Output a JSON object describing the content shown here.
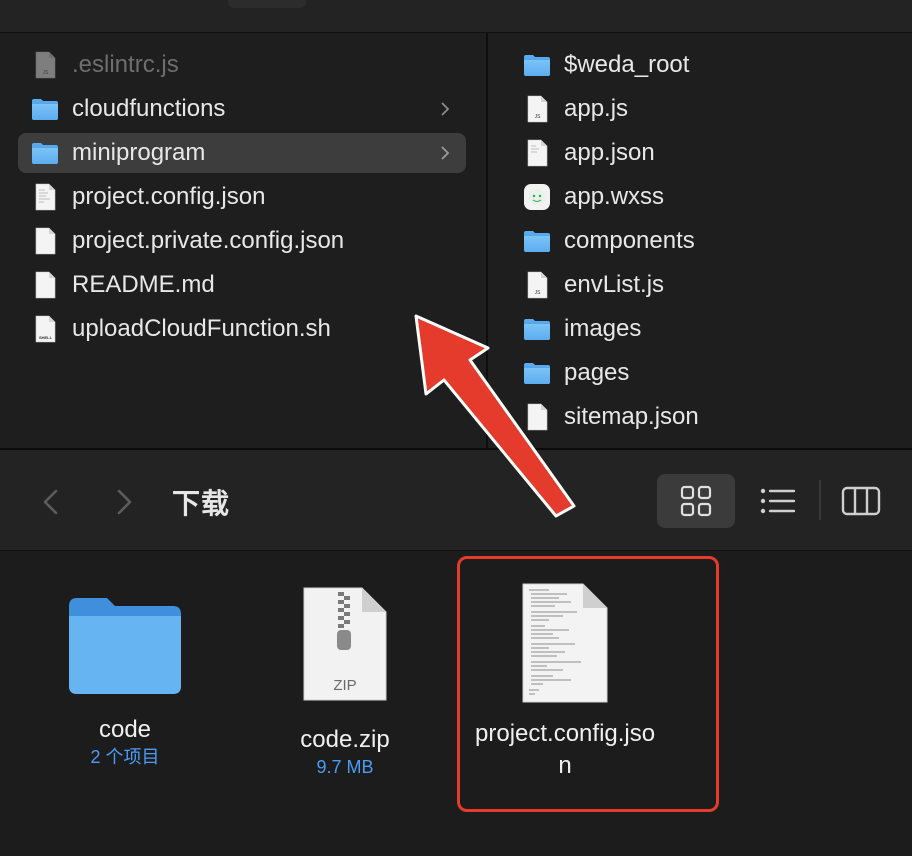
{
  "left_column": {
    "items": [
      {
        "name": ".eslintrc.js",
        "icon": "js-file-icon",
        "dim": true
      },
      {
        "name": "cloudfunctions",
        "icon": "folder-icon",
        "chevron": true
      },
      {
        "name": "miniprogram",
        "icon": "folder-icon",
        "chevron": true,
        "selected": true
      },
      {
        "name": "project.config.json",
        "icon": "json-file-icon"
      },
      {
        "name": "project.private.config.json",
        "icon": "document-icon"
      },
      {
        "name": "README.md",
        "icon": "document-icon"
      },
      {
        "name": "uploadCloudFunction.sh",
        "icon": "shell-file-icon"
      }
    ]
  },
  "right_column": {
    "items": [
      {
        "name": "$weda_root",
        "icon": "folder-icon"
      },
      {
        "name": "app.js",
        "icon": "js-file-icon"
      },
      {
        "name": "app.json",
        "icon": "json-file-icon"
      },
      {
        "name": "app.wxss",
        "icon": "wxss-file-icon"
      },
      {
        "name": "components",
        "icon": "folder-icon"
      },
      {
        "name": "envList.js",
        "icon": "js-file-icon"
      },
      {
        "name": "images",
        "icon": "folder-icon"
      },
      {
        "name": "pages",
        "icon": "folder-icon"
      },
      {
        "name": "sitemap.json",
        "icon": "document-icon"
      }
    ]
  },
  "toolbar": {
    "title": "下载",
    "back_icon": "chevron-left-icon",
    "forward_icon": "chevron-right-icon",
    "views": [
      "grid-view-icon",
      "list-view-icon",
      "column-view-icon"
    ],
    "active_view": "grid-view-icon"
  },
  "icon_view": {
    "items": [
      {
        "name": "code",
        "meta": "2 个项目",
        "icon": "folder-icon"
      },
      {
        "name": "code.zip",
        "meta": "9.7 MB",
        "icon": "zip-file-icon",
        "zip_label": "ZIP"
      },
      {
        "name_line1": "project.config.jso",
        "name_line2": "n",
        "icon": "json-file-icon"
      }
    ]
  },
  "annotation": {
    "arrow_color": "#e53b2c",
    "highlight_color": "#e53b2c"
  },
  "file_badges": {
    "js": "JS",
    "shell": "SHELL"
  }
}
